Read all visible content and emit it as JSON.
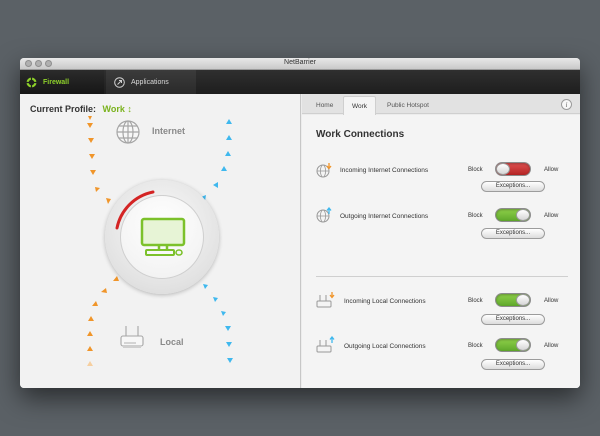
{
  "window": {
    "title": "NetBarrier"
  },
  "toolbar": {
    "tabs": [
      {
        "label": "Firewall",
        "icon": "firewall-icon",
        "active": true
      },
      {
        "label": "Applications",
        "icon": "applications-icon",
        "active": false
      }
    ]
  },
  "left_pane": {
    "profile_label": "Current Profile:",
    "profile_value": "Work",
    "profile_value_suffix": "↕",
    "zones": {
      "top": "Internet",
      "bottom": "Local"
    },
    "colors": {
      "incoming_arrows": "#f0952a",
      "outgoing_arrows": "#3fb8ee",
      "accent_arc": "#d42424",
      "monitor": "#7cc12b"
    }
  },
  "right_pane": {
    "tabs": [
      {
        "label": "Home",
        "active": false
      },
      {
        "label": "Work",
        "active": true
      },
      {
        "label": "Public Hotspot",
        "active": false
      }
    ],
    "info_symbol": "i",
    "heading": "Work Connections",
    "connections": [
      {
        "label": "Incoming Internet Connections",
        "icon": "incoming-globe-icon",
        "block_label": "Block",
        "allow_label": "Allow",
        "state": "block",
        "exceptions_label": "Exceptions..."
      },
      {
        "label": "Outgoing Internet Connections",
        "icon": "outgoing-globe-icon",
        "block_label": "Block",
        "allow_label": "Allow",
        "state": "allow",
        "exceptions_label": "Exceptions..."
      },
      {
        "label": "Incoming Local Connections",
        "icon": "incoming-router-icon",
        "block_label": "Block",
        "allow_label": "Allow",
        "state": "allow",
        "exceptions_label": "Exceptions..."
      },
      {
        "label": "Outgoing Local Connections",
        "icon": "outgoing-router-icon",
        "block_label": "Block",
        "allow_label": "Allow",
        "state": "allow",
        "exceptions_label": "Exceptions..."
      }
    ]
  }
}
